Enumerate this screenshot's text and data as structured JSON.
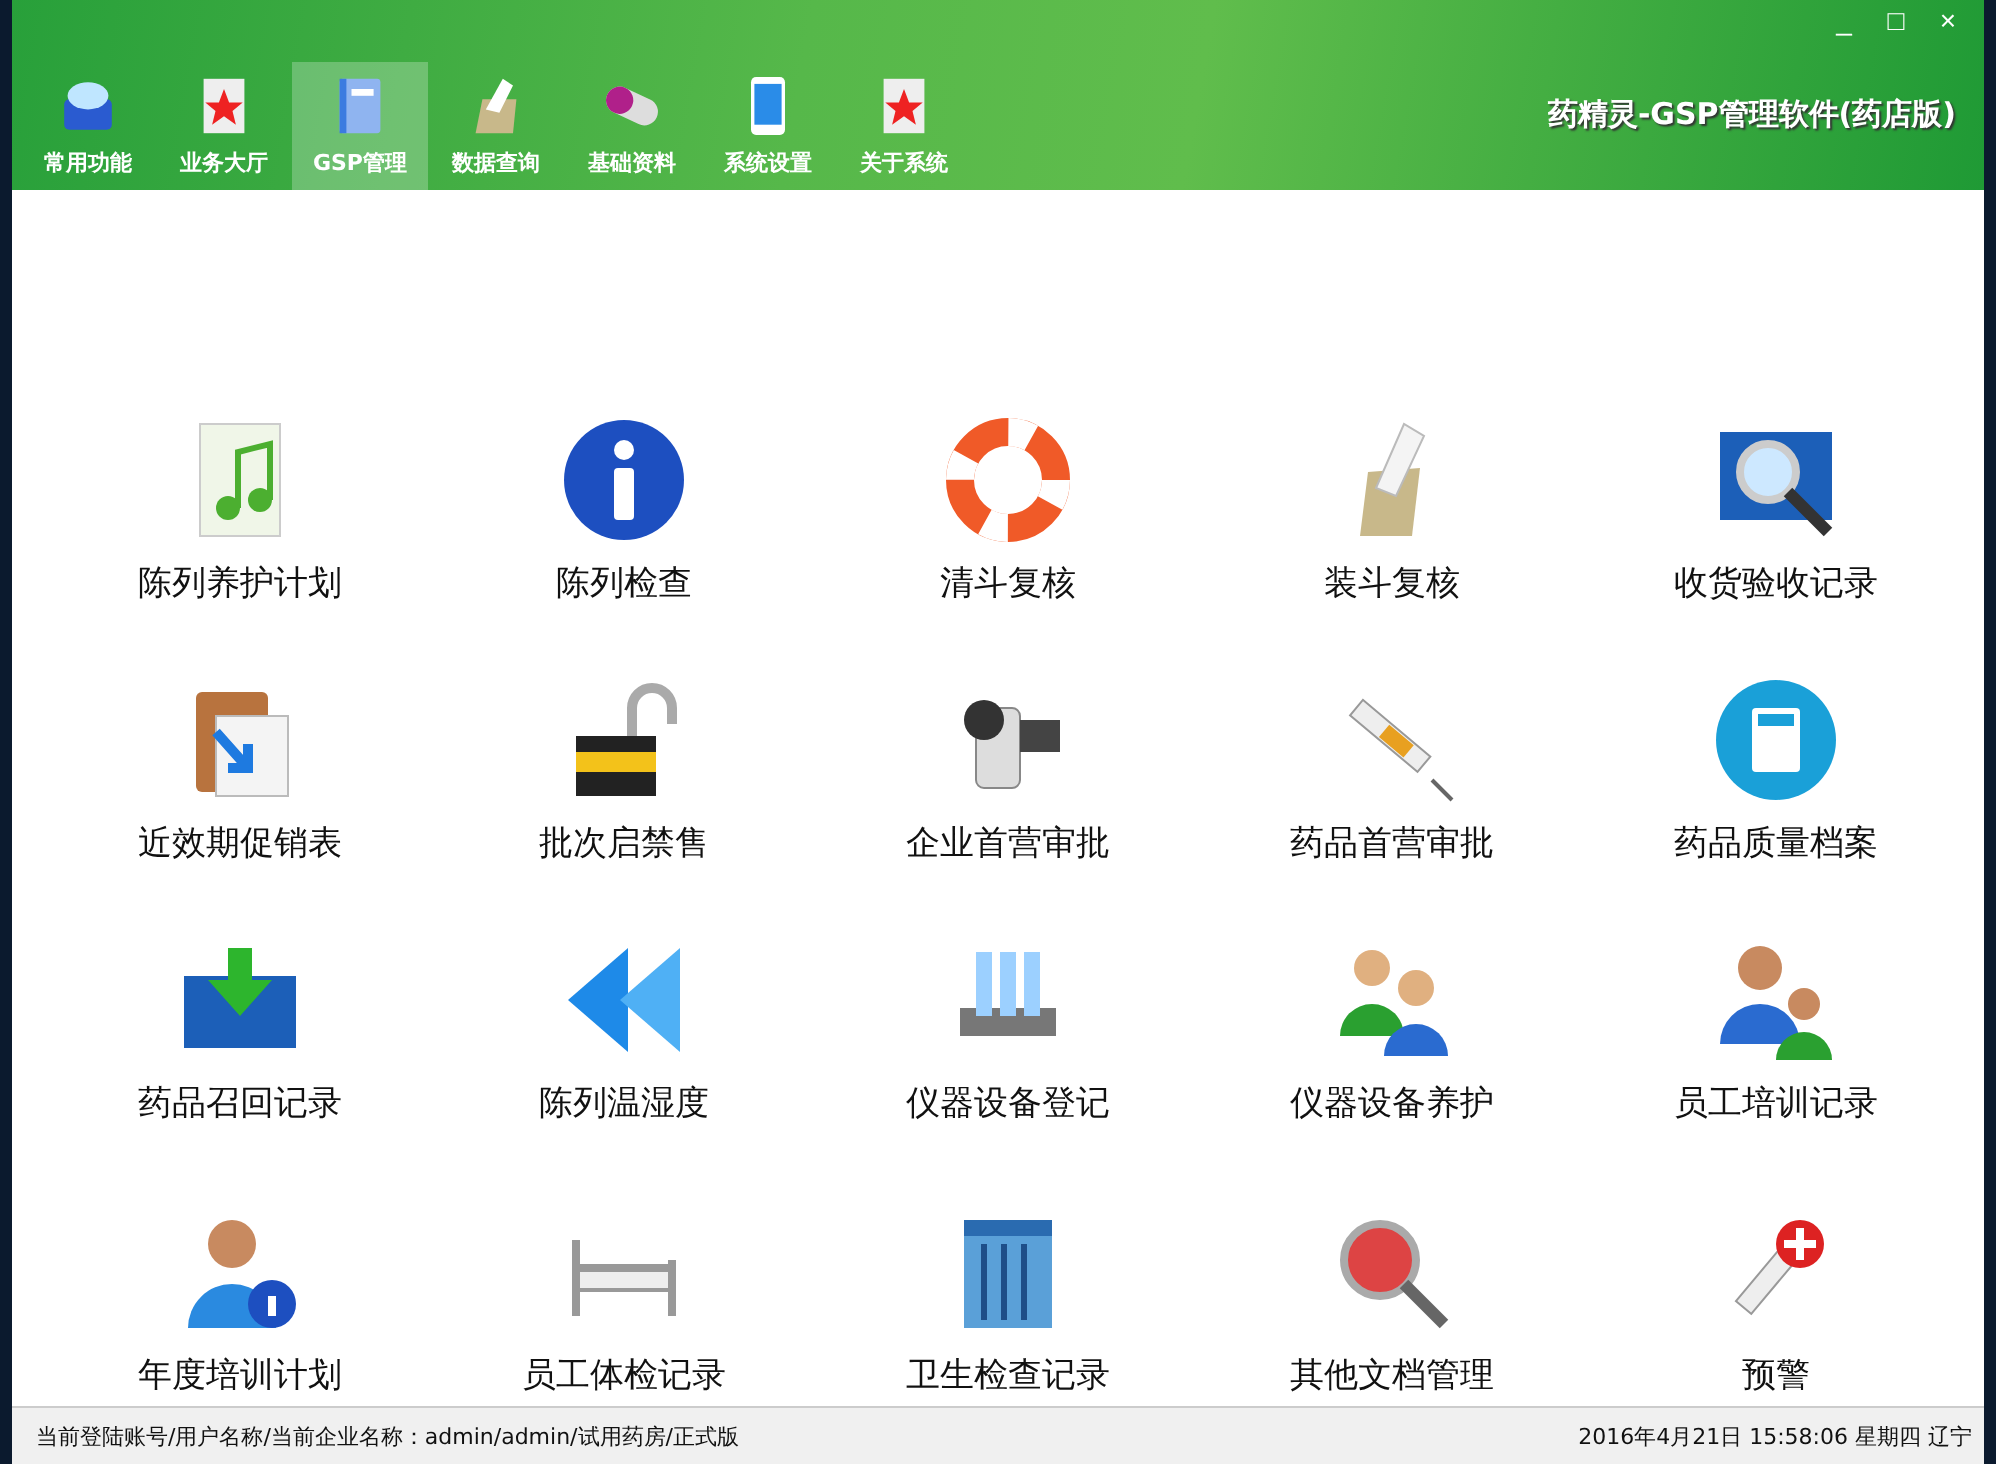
{
  "window": {
    "title": "药精灵-GSP管理软件(药店版)"
  },
  "window_controls": [
    "_",
    "□",
    "×"
  ],
  "tabs": [
    {
      "label": "常用功能",
      "selected": false
    },
    {
      "label": "业务大厅",
      "selected": false
    },
    {
      "label": "GSP管理",
      "selected": true
    },
    {
      "label": "数据查询",
      "selected": false
    },
    {
      "label": "基础资料",
      "selected": false
    },
    {
      "label": "系统设置",
      "selected": false
    },
    {
      "label": "关于系统",
      "selected": false
    }
  ],
  "functions": [
    {
      "label": "陈列养护计划"
    },
    {
      "label": "陈列检查"
    },
    {
      "label": "清斗复核"
    },
    {
      "label": "装斗复核"
    },
    {
      "label": "收货验收记录"
    },
    {
      "label": "近效期促销表"
    },
    {
      "label": "批次启禁售"
    },
    {
      "label": "企业首营审批"
    },
    {
      "label": "药品首营审批"
    },
    {
      "label": "药品质量档案"
    },
    {
      "label": "药品召回记录"
    },
    {
      "label": "陈列温湿度"
    },
    {
      "label": "仪器设备登记"
    },
    {
      "label": "仪器设备养护"
    },
    {
      "label": "员工培训记录"
    },
    {
      "label": "年度培训计划"
    },
    {
      "label": "员工体检记录"
    },
    {
      "label": "卫生检查记录"
    },
    {
      "label": "其他文档管理"
    },
    {
      "label": "预警"
    }
  ],
  "status_bar": {
    "account": "当前登陆账号/用户名称/当前企业名称：admin/admin/试用药房/正式版",
    "datetime": "2016年4月21日 15:58:06 星期四 辽宁"
  }
}
